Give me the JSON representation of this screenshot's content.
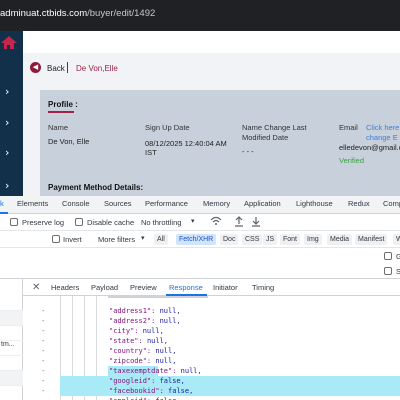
{
  "browser": {
    "url_host": "adminuat.ctbids.com",
    "url_path": "/buyer/edit/1492"
  },
  "app": {
    "back_label": "Back",
    "buyer_name": "De Von,Elle",
    "profile_heading": "Profile :",
    "fields": {
      "name_label": "Name",
      "name_value": "De Von, Elle",
      "signup_label": "Sign Up Date",
      "signup_value_1": "08/12/2025 12:40:04 AM",
      "signup_value_2": "IST",
      "namechange_label_1": "Name Change Last",
      "namechange_label_2": "Modified Date",
      "namechange_value": "- - -",
      "email_label": "Email",
      "email_link_1": "Click here",
      "email_link_2": "change E",
      "email_value": "elledevon@gmail.c",
      "email_status": "Verified"
    },
    "payment_heading": "Payment Method Details:"
  },
  "devtools": {
    "tabs": [
      "k",
      "Elements",
      "Console",
      "Sources",
      "Performance",
      "Memory",
      "Application",
      "Lighthouse",
      "Redux",
      "Comp"
    ],
    "active_tab": "Network",
    "toolbar": {
      "preserve_log": "Preserve log",
      "disable_cache": "Disable cache",
      "throttling": "No throttling"
    },
    "filters": {
      "invert": "Invert",
      "more_filters": "More filters",
      "types": [
        "All",
        "Fetch/XHR",
        "Doc",
        "CSS",
        "JS",
        "Font",
        "Img",
        "Media",
        "Manifest",
        "W"
      ],
      "selected_type": "Fetch/XHR"
    },
    "right_options": [
      "G",
      "S"
    ],
    "request_rows": [
      "",
      "",
      "",
      "tm...",
      "",
      ""
    ],
    "detail_tabs": [
      "Headers",
      "Payload",
      "Preview",
      "Response",
      "Initiator",
      "Timing"
    ],
    "active_detail_tab": "Response",
    "response_lines": [
      {
        "key": "\"address1\"",
        "val": "null,"
      },
      {
        "key": "\"address2\"",
        "val": "null,"
      },
      {
        "key": "\"city\"",
        "val": "null,"
      },
      {
        "key": "\"state\"",
        "val": "null,"
      },
      {
        "key": "\"country\"",
        "val": "null,"
      },
      {
        "key": "\"zipcode\"",
        "val": "null,"
      },
      {
        "key": "\"taxexemptdate\"",
        "val": "null,"
      },
      {
        "key": "\"googleid\"",
        "val": "false,"
      },
      {
        "key": "\"facebookid\"",
        "val": "false,"
      },
      {
        "key": "\"appleid\"",
        "val": "false"
      }
    ],
    "gutter_mark": "-"
  }
}
